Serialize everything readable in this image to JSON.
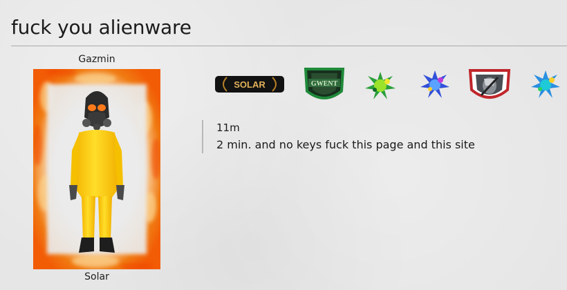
{
  "topic": {
    "title": "fuck you alienware"
  },
  "user": {
    "name": "Gazmin",
    "rank": "Solar",
    "avatar_icon": "hazmat-suit-avatar-icon"
  },
  "badges": [
    {
      "icon": "solar-rank-badge-icon",
      "text": "SOLAR"
    },
    {
      "icon": "gwent-badge-icon",
      "text": "GWENT"
    },
    {
      "icon": "green-splash-badge-icon"
    },
    {
      "icon": "blue-splash-badge-icon"
    },
    {
      "icon": "witcher-shield-badge-icon"
    },
    {
      "icon": "rainbow-splash-badge-icon"
    }
  ],
  "post": {
    "time": "11m",
    "body": "2 min. and no keys fuck this page and this site"
  },
  "colors": {
    "background": "#e6e6e6",
    "rule": "#a9a9a9",
    "text": "#1a1a1a",
    "fire_orange": "#f26a0a",
    "suit_yellow": "#ffcc00",
    "witcher_red": "#c0262b",
    "gwent_green": "#1f8a3a"
  }
}
